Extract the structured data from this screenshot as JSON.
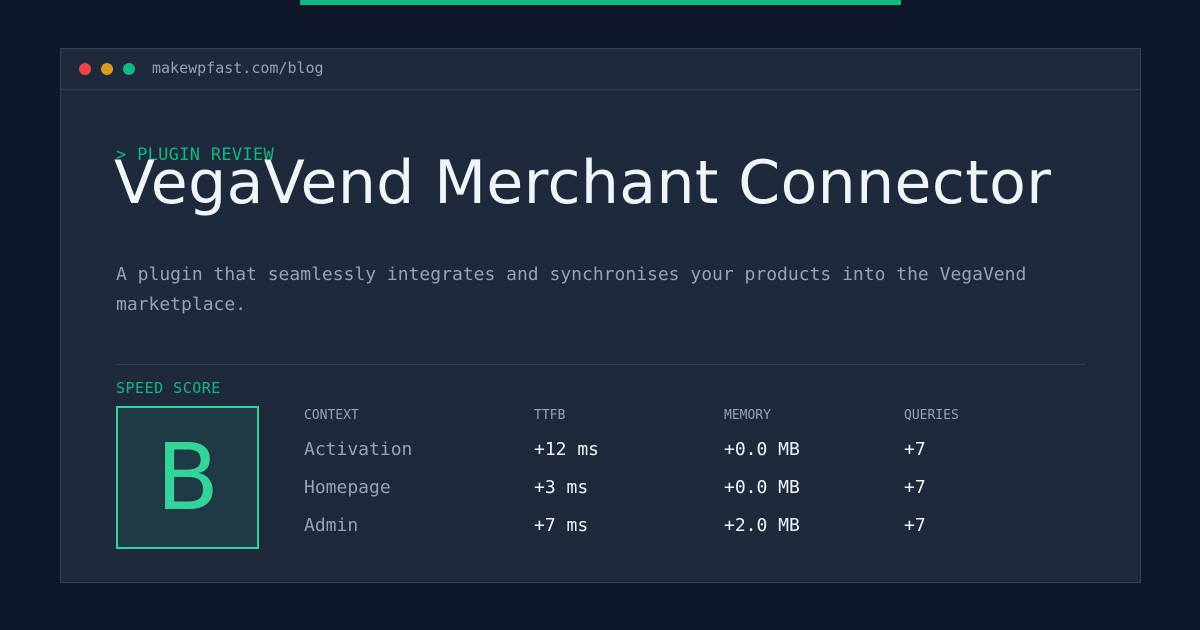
{
  "browser": {
    "url": "makewpfast.com/blog"
  },
  "post": {
    "eyebrow": "> PLUGIN REVIEW",
    "title": "VegaVend Merchant Connector",
    "description": "A plugin that seamlessly integrates and synchronises your products into the VegaVend marketplace."
  },
  "score": {
    "label": "SPEED SCORE",
    "grade": "B"
  },
  "metrics": {
    "headers": [
      "CONTEXT",
      "TTFB",
      "MEMORY",
      "QUERIES"
    ],
    "rows": [
      [
        "Activation",
        "+12 ms",
        "+0.0 MB",
        "+7"
      ],
      [
        "Homepage",
        "+3 ms",
        "+0.0 MB",
        "+7"
      ],
      [
        "Admin",
        "+7 ms",
        "+2.0 MB",
        "+7"
      ]
    ]
  },
  "colors": {
    "background": "#0f172a",
    "card": "#1e293b",
    "accent": "#10b981",
    "grade": "#34d399",
    "muted_text": "#94a3b8",
    "text": "#f1f5f9"
  }
}
